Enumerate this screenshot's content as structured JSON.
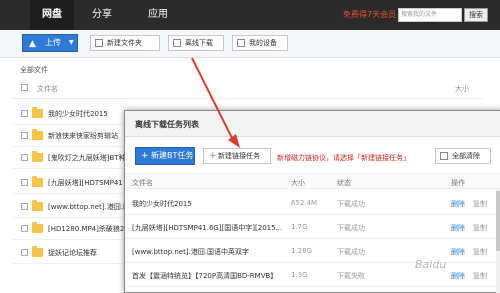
{
  "topbar": {
    "nav": [
      "网盘",
      "分享",
      "应用"
    ],
    "vip": "免费得7天会员",
    "search_placeholder": "搜索我的文件",
    "search_button": "搜索"
  },
  "toolbar": {
    "upload": "上传",
    "new_folder": "新建文件夹",
    "offline": "离线下载",
    "devices": "我的设备"
  },
  "breadcrumb": "全部文件",
  "file_list": {
    "col_name": "文件名",
    "col_size": "大小",
    "rows": [
      "我的少女时代2015",
      "新浪侠来侠家纷剪辑站",
      "[鬼吹灯之九层妖塔]BT种",
      "[九层妖塔][HDTSMP41",
      "[www.bttop.net].港囧.国",
      "[HD1280.MP4]杀破狼2",
      "捉妖记论坛推荐"
    ]
  },
  "dialog": {
    "title": "离线下载任务列表",
    "new_bt": "新建BT任务",
    "new_link": "新建链接任务",
    "tip": "新增磁力链协议，请选择「新建链接任务」",
    "clear_all": "全部清除",
    "columns": {
      "name": "文件名",
      "size": "大小",
      "status": "状态",
      "ops": "操作"
    },
    "rows": [
      {
        "name": "我的少女时代2015",
        "size": "652.4M",
        "status": "下载成功",
        "op1": "删除",
        "op2": "复制"
      },
      {
        "name": "[九层妖塔][HDTSMP41.6G][国语中字][2015...",
        "size": "1.7G",
        "status": "下载成功",
        "op1": "删除",
        "op2": "复制"
      },
      {
        "name": "[www.bttop.net].港囧.国语中英双字",
        "size": "1.28G",
        "status": "下载成功",
        "op1": "删除",
        "op2": "复制"
      },
      {
        "name": "首发【震涵特统览】【720P高清国BD-RMVB】",
        "size": "1.3G",
        "status": "下载失败",
        "op1": "删除",
        "op2": "复制"
      }
    ]
  },
  "watermark": "Baidu",
  "colors": {
    "accent": "#2e7bd6",
    "topbar": "#2b2b2b",
    "arrow": "#e03c2c",
    "warning": "#d9241c"
  }
}
